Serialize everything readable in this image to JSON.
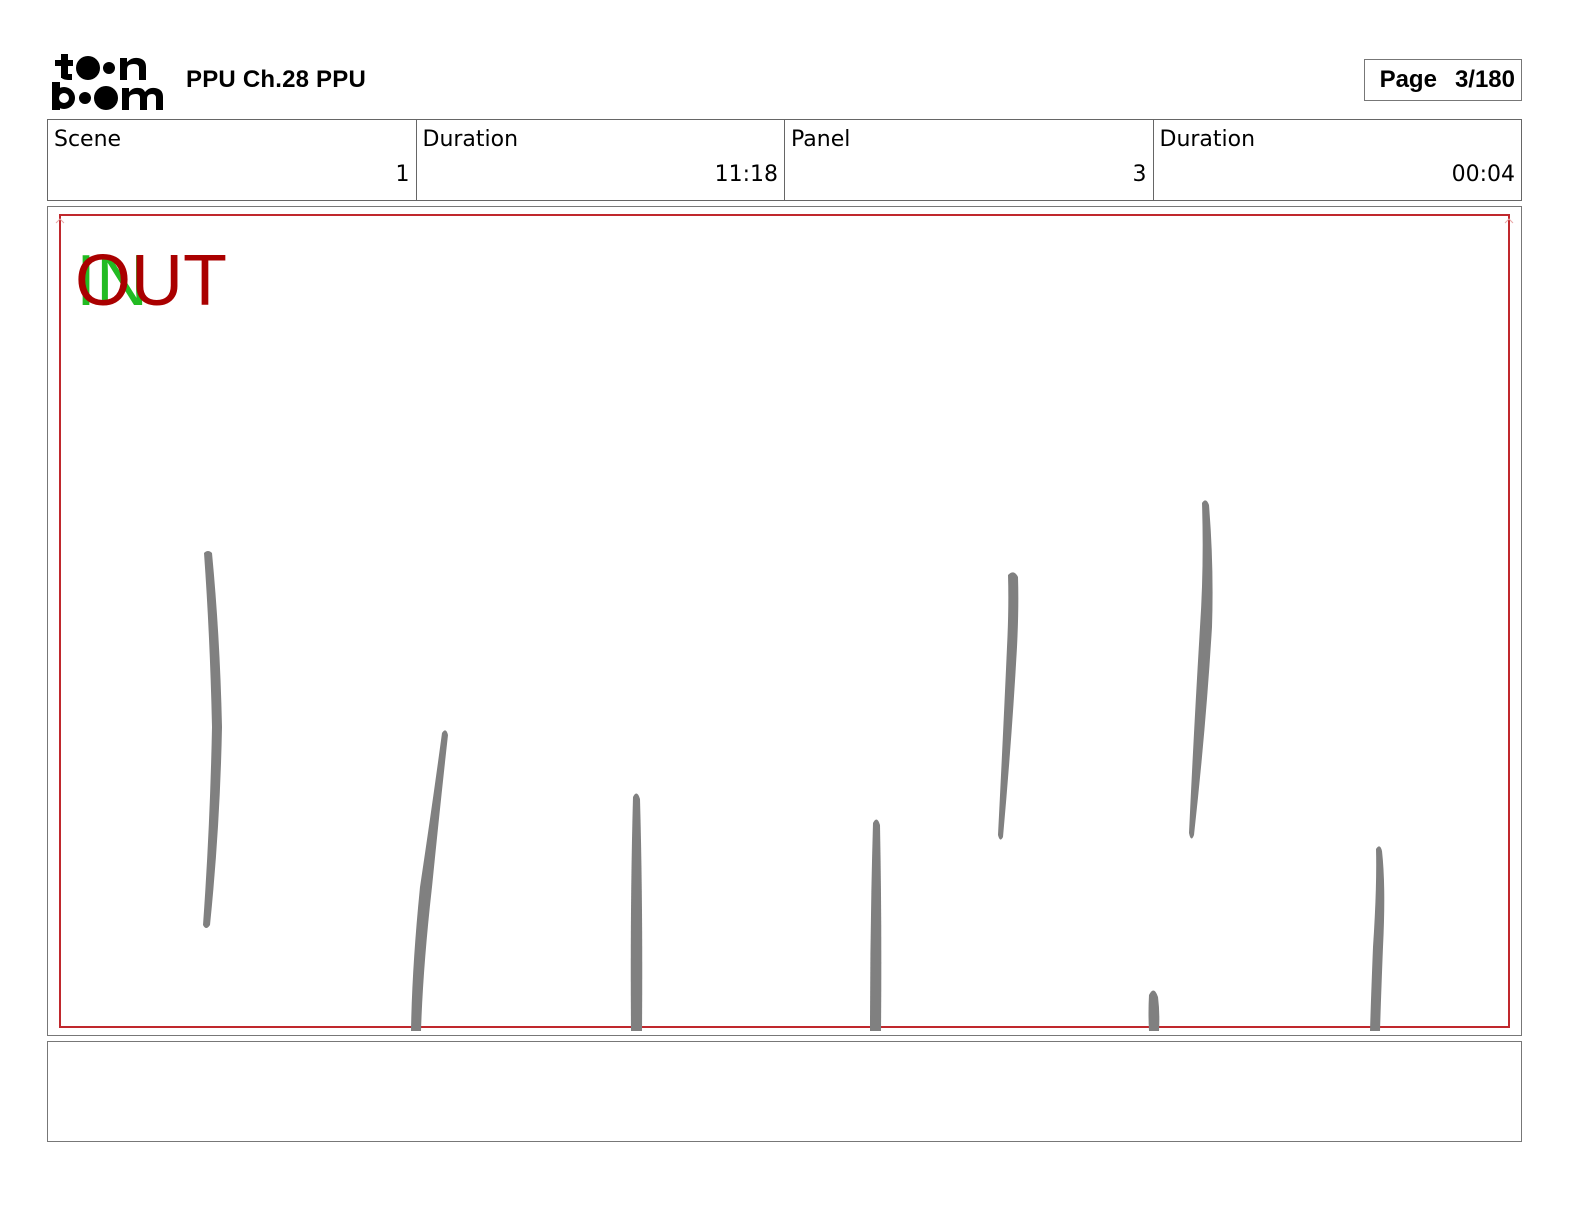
{
  "header": {
    "logo_alt": "toon boom",
    "title": "PPU Ch.28  PPU",
    "page_label": "Page",
    "page_value": "3/180"
  },
  "info": {
    "scene_label": "Scene",
    "scene_value": "1",
    "scene_duration_label": "Duration",
    "scene_duration_value": "11:18",
    "panel_label": "Panel",
    "panel_value": "3",
    "panel_duration_label": "Duration",
    "panel_duration_value": "00:04"
  },
  "panel": {
    "in_marker": "IN",
    "out_marker": "OUT",
    "in_color": "#22bb22",
    "out_color": "#aa0000",
    "safe_frame_color": "#c0282d",
    "stroke_color": "#808080"
  },
  "notes": {
    "text": ""
  }
}
